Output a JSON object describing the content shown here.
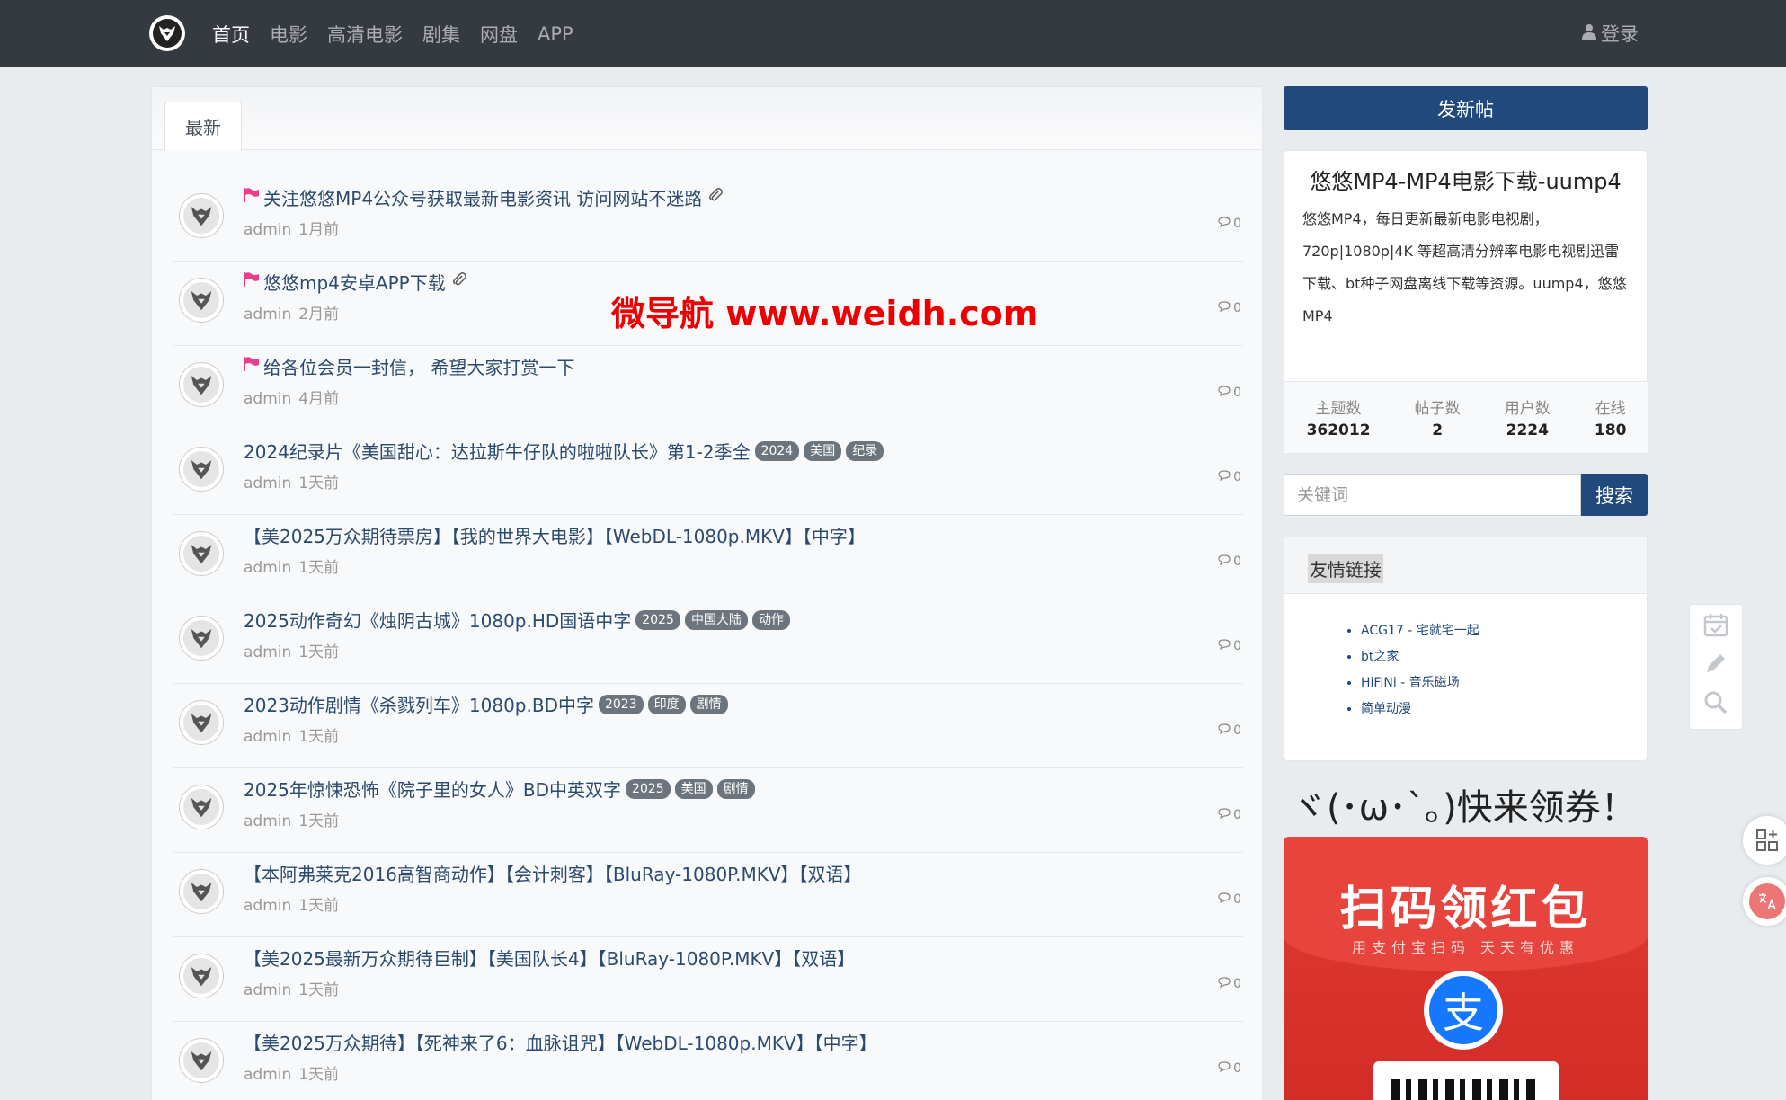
{
  "nav": {
    "items": [
      "首页",
      "电影",
      "高清电影",
      "剧集",
      "网盘",
      "APP"
    ],
    "login": "登录"
  },
  "main": {
    "tab": "最新",
    "threads": [
      {
        "flag": true,
        "title": "关注悠悠MP4公众号获取最新电影资讯 访问网站不迷路",
        "attach": true,
        "tags": [],
        "author": "admin",
        "time": "1月前",
        "replies": "0"
      },
      {
        "flag": true,
        "title": "悠悠mp4安卓APP下载",
        "attach": true,
        "tags": [],
        "author": "admin",
        "time": "2月前",
        "replies": "0"
      },
      {
        "flag": true,
        "title": "给各位会员一封信， 希望大家打赏一下",
        "attach": false,
        "tags": [],
        "author": "admin",
        "time": "4月前",
        "replies": "0"
      },
      {
        "flag": false,
        "title": "2024纪录片《美国甜心：达拉斯牛仔队的啦啦队长》第1-2季全",
        "attach": false,
        "tags": [
          "2024",
          "美国",
          "纪录"
        ],
        "author": "admin",
        "time": "1天前",
        "replies": "0"
      },
      {
        "flag": false,
        "title": "【美2025万众期待票房】【我的世界大电影】【WebDL-1080p.MKV】【中字】",
        "attach": false,
        "tags": [],
        "author": "admin",
        "time": "1天前",
        "replies": "0"
      },
      {
        "flag": false,
        "title": "2025动作奇幻《烛阴古城》1080p.HD国语中字",
        "attach": false,
        "tags": [
          "2025",
          "中国大陆",
          "动作"
        ],
        "author": "admin",
        "time": "1天前",
        "replies": "0"
      },
      {
        "flag": false,
        "title": "2023动作剧情《杀戮列车》1080p.BD中字",
        "attach": false,
        "tags": [
          "2023",
          "印度",
          "剧情"
        ],
        "author": "admin",
        "time": "1天前",
        "replies": "0"
      },
      {
        "flag": false,
        "title": "2025年惊悚恐怖《院子里的女人》BD中英双字",
        "attach": false,
        "tags": [
          "2025",
          "美国",
          "剧情"
        ],
        "author": "admin",
        "time": "1天前",
        "replies": "0"
      },
      {
        "flag": false,
        "title": "【本阿弗莱克2016高智商动作】【会计刺客】【BluRay-1080P.MKV】【双语】",
        "attach": false,
        "tags": [],
        "author": "admin",
        "time": "1天前",
        "replies": "0"
      },
      {
        "flag": false,
        "title": "【美2025最新万众期待巨制】【美国队长4】【BluRay-1080P.MKV】【双语】",
        "attach": false,
        "tags": [],
        "author": "admin",
        "time": "1天前",
        "replies": "0"
      },
      {
        "flag": false,
        "title": "【美2025万众期待】【死神来了6：血脉诅咒】【WebDL-1080p.MKV】【中字】",
        "attach": false,
        "tags": [],
        "author": "admin",
        "time": "1天前",
        "replies": "0"
      }
    ],
    "watermark": "微导航 www.weidh.com"
  },
  "sidebar": {
    "new_post": "发新帖",
    "site_title": "悠悠MP4-MP4电影下载-uump4",
    "site_desc": "悠悠MP4，每日更新最新电影电视剧，720p|1080p|4K 等超高清分辨率电影电视剧迅雷下载、bt种子网盘离线下载等资源。uump4，悠悠MP4",
    "stats": [
      {
        "label": "主题数",
        "value": "362012"
      },
      {
        "label": "帖子数",
        "value": "2"
      },
      {
        "label": "用户数",
        "value": "2224"
      },
      {
        "label": "在线",
        "value": "180"
      }
    ],
    "search": {
      "placeholder": "关键词",
      "button": "搜索"
    },
    "links": {
      "title": "友情链接",
      "items": [
        "ACG17 - 宅就宅一起",
        "bt之家",
        "HiFiNi - 音乐磁场",
        "简单动漫"
      ]
    },
    "promo": {
      "title": "ヾ(･ω･`｡)快来领券！",
      "rp_title": "扫码领红包",
      "rp_sub": "用支付宝扫码 天天有优惠",
      "alipay_char": "支"
    }
  }
}
